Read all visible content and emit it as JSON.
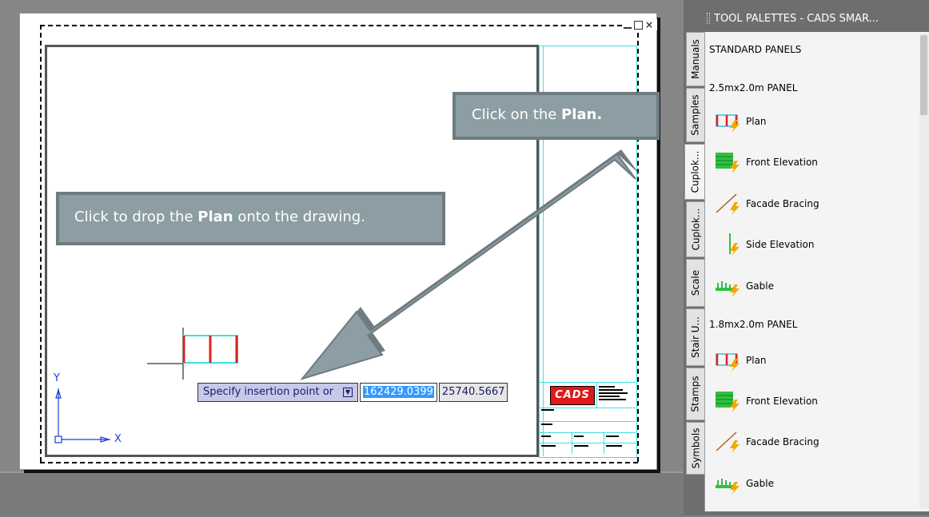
{
  "callouts": {
    "plan": {
      "text": "Click on the ",
      "bold": "Plan."
    },
    "drop": {
      "text1": "Click to drop the ",
      "bold": "Plan",
      "text2": " onto the drawing."
    }
  },
  "command_line": {
    "prompt": "Specify insertion point or",
    "x_value": "162429.0399",
    "y_value": "25740.5667"
  },
  "ucs": {
    "x": "X",
    "y": "Y"
  },
  "title_block": {
    "logo": "CADS"
  },
  "palette": {
    "title": "TOOL PALETTES - CADS SMAR...",
    "tabs": [
      "Manuals",
      "Samples",
      "Cuplok...",
      "Cuplok...",
      "Scale",
      "Stair U...",
      "Stamps",
      "Symbols"
    ],
    "sections": [
      {
        "heading": "STANDARD PANELS"
      },
      {
        "heading": "2.5mx2.0m PANEL",
        "items": [
          "Plan",
          "Front Elevation",
          "Facade Bracing",
          "Side Elevation",
          "Gable"
        ]
      },
      {
        "heading": "1.8mx2.0m PANEL",
        "items": [
          "Plan",
          "Front Elevation",
          "Facade Bracing",
          "Gable"
        ]
      }
    ]
  }
}
